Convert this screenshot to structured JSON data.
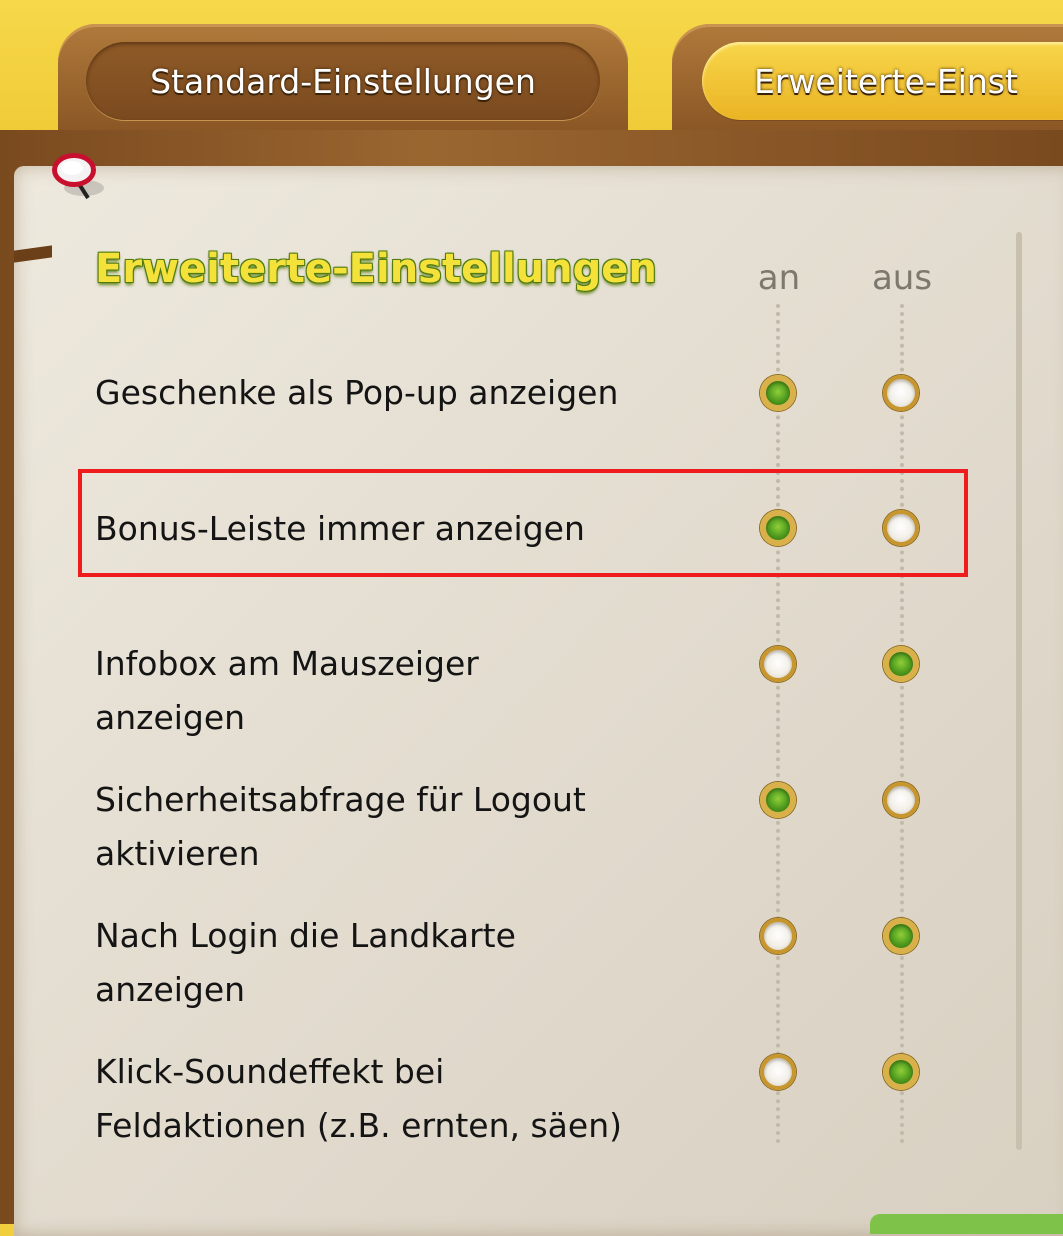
{
  "tabs": [
    {
      "label": "Standard-Einstellungen",
      "active": false
    },
    {
      "label": "Erweiterte-Einst",
      "active": true
    }
  ],
  "panel": {
    "heading": "Erweiterte-Einstellungen",
    "columns": {
      "on": "an",
      "off": "aus"
    }
  },
  "settings": [
    {
      "line1": "Geschenke als Pop-up anzeigen",
      "line2": "",
      "value": "an"
    },
    {
      "line1": "Bonus-Leiste immer anzeigen",
      "line2": "",
      "value": "an",
      "highlighted": true
    },
    {
      "line1": "Infobox am Mauszeiger",
      "line2": "anzeigen",
      "value": "aus"
    },
    {
      "line1": "Sicherheitsabfrage für Logout",
      "line2": "aktivieren",
      "value": "an"
    },
    {
      "line1": "Nach Login die Landkarte",
      "line2": "anzeigen",
      "value": "aus"
    },
    {
      "line1": "Klick-Soundeffekt bei",
      "line2": "Feldaktionen (z.B. ernten, säen)",
      "value": "aus"
    }
  ],
  "colors": {
    "highlight": "#ee1c1c",
    "checked": "#4e9a1e",
    "heading": "#f4e13a"
  },
  "icons": {
    "pin": "pin-icon"
  }
}
